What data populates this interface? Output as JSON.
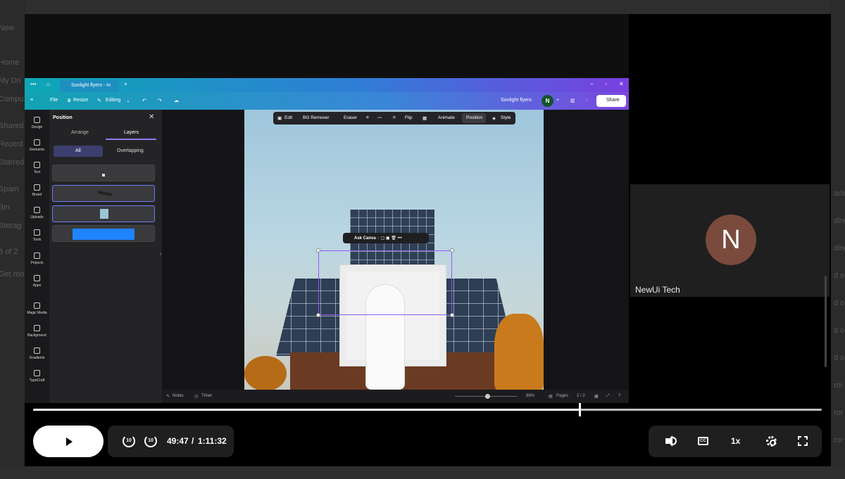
{
  "background": {
    "left_items": [
      "New",
      "Home",
      "My Dri",
      "Compu",
      "Shared",
      "Recent",
      "Starred",
      "Spam",
      "Bin",
      "Storag",
      "8 of 2",
      "Get mo"
    ],
    "right_items": [
      "ading",
      "ding",
      "ding",
      "d o",
      "d o",
      "d o",
      "d o",
      "ror c",
      "ror c",
      "ror c"
    ]
  },
  "canva": {
    "tab_title": "Sonlight flyers - In",
    "toolbar": {
      "file": "File",
      "resize": "Resize",
      "editing": "Editing",
      "doc_title": "Sonlight flyers",
      "user_initial": "N",
      "share": "Share"
    },
    "rail": [
      "Design",
      "Elements",
      "Text",
      "Brand",
      "Uploads",
      "Tools",
      "Projects",
      "Apps",
      "Magic Media",
      "Background",
      "Gradients",
      "TypeCraft"
    ],
    "panel": {
      "title": "Position",
      "tab_arrange": "Arrange",
      "tab_layers": "Layers",
      "filter_all": "All",
      "filter_overlapping": "Overlapping"
    },
    "float_toolbar": [
      "Edit",
      "BG Remover",
      "Eraser",
      "Flip",
      "Animate",
      "Position",
      "Style"
    ],
    "context_bar": {
      "ask": "Ask Canva"
    },
    "bottom": {
      "notes": "Notes",
      "timer": "Timer",
      "zoom": "88%",
      "pages": "Pages",
      "page_count": "2 / 2"
    }
  },
  "participant": {
    "initial": "N",
    "name": "NewUi Tech"
  },
  "player": {
    "current_time": "49:47",
    "duration": "1:11:32",
    "speed": "1x",
    "cc": "CC",
    "skip_back": "10",
    "skip_fwd": "10",
    "progress": 0.694
  },
  "colors": {
    "accent": "#8b5cf6",
    "avatar": "#7a4a3c",
    "canva_user": "#14532d"
  }
}
